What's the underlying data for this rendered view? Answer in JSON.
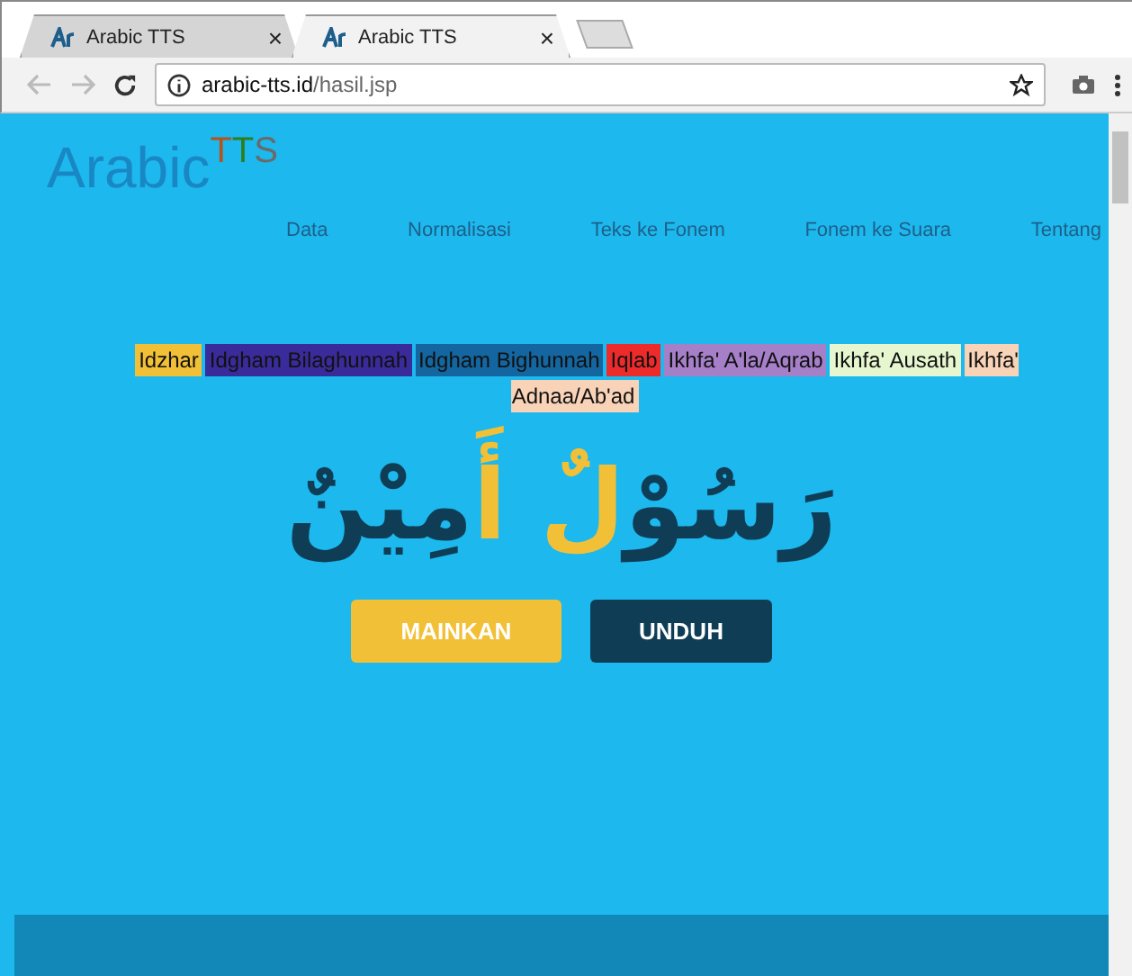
{
  "browser": {
    "tabs": [
      {
        "title": "Arabic TTS",
        "selected": false
      },
      {
        "title": "Arabic TTS",
        "selected": true
      }
    ],
    "close_glyph": "×",
    "url_host": "arabic-tts.id",
    "url_path": "/hasil.jsp"
  },
  "site": {
    "logo_main": "Arabic",
    "logo_accent": [
      {
        "text": "T",
        "color": "#b5531a"
      },
      {
        "text": "T",
        "color": "#2f7d1e"
      },
      {
        "text": "S",
        "color": "#6a6a6a"
      }
    ],
    "nav": [
      {
        "label": "Data"
      },
      {
        "label": "Normalisasi"
      },
      {
        "label": "Teks ke Fonem"
      },
      {
        "label": "Fonem ke Suara"
      },
      {
        "label": "Tentang"
      }
    ]
  },
  "legend": [
    {
      "label": "Idzhar",
      "color": "#f2c037"
    },
    {
      "label": "Idgham Bilaghunnah",
      "color": "#3a2b9a"
    },
    {
      "label": "Idgham Bighunnah",
      "color": "#1466a0"
    },
    {
      "label": "Iqlab",
      "color": "#ee2b2b"
    },
    {
      "label": "Ikhfa' A'la/Aqrab",
      "color": "#a67fc9"
    },
    {
      "label": "Ikhfa' Ausath",
      "color": "#e6f7cf"
    },
    {
      "label": "Ikhfa' Adnaa/Ab'ad",
      "color": "#f9d3b8"
    }
  ],
  "arabic": [
    {
      "text": "رَسُوْ",
      "color": "#0f3d56"
    },
    {
      "text": "لٌ أَ",
      "color": "#f2c037"
    },
    {
      "text": "مِيْنٌ",
      "color": "#0f3d56"
    }
  ],
  "buttons": [
    {
      "label": "MAINKAN",
      "kind": "play"
    },
    {
      "label": "UNDUH",
      "kind": "download"
    }
  ]
}
